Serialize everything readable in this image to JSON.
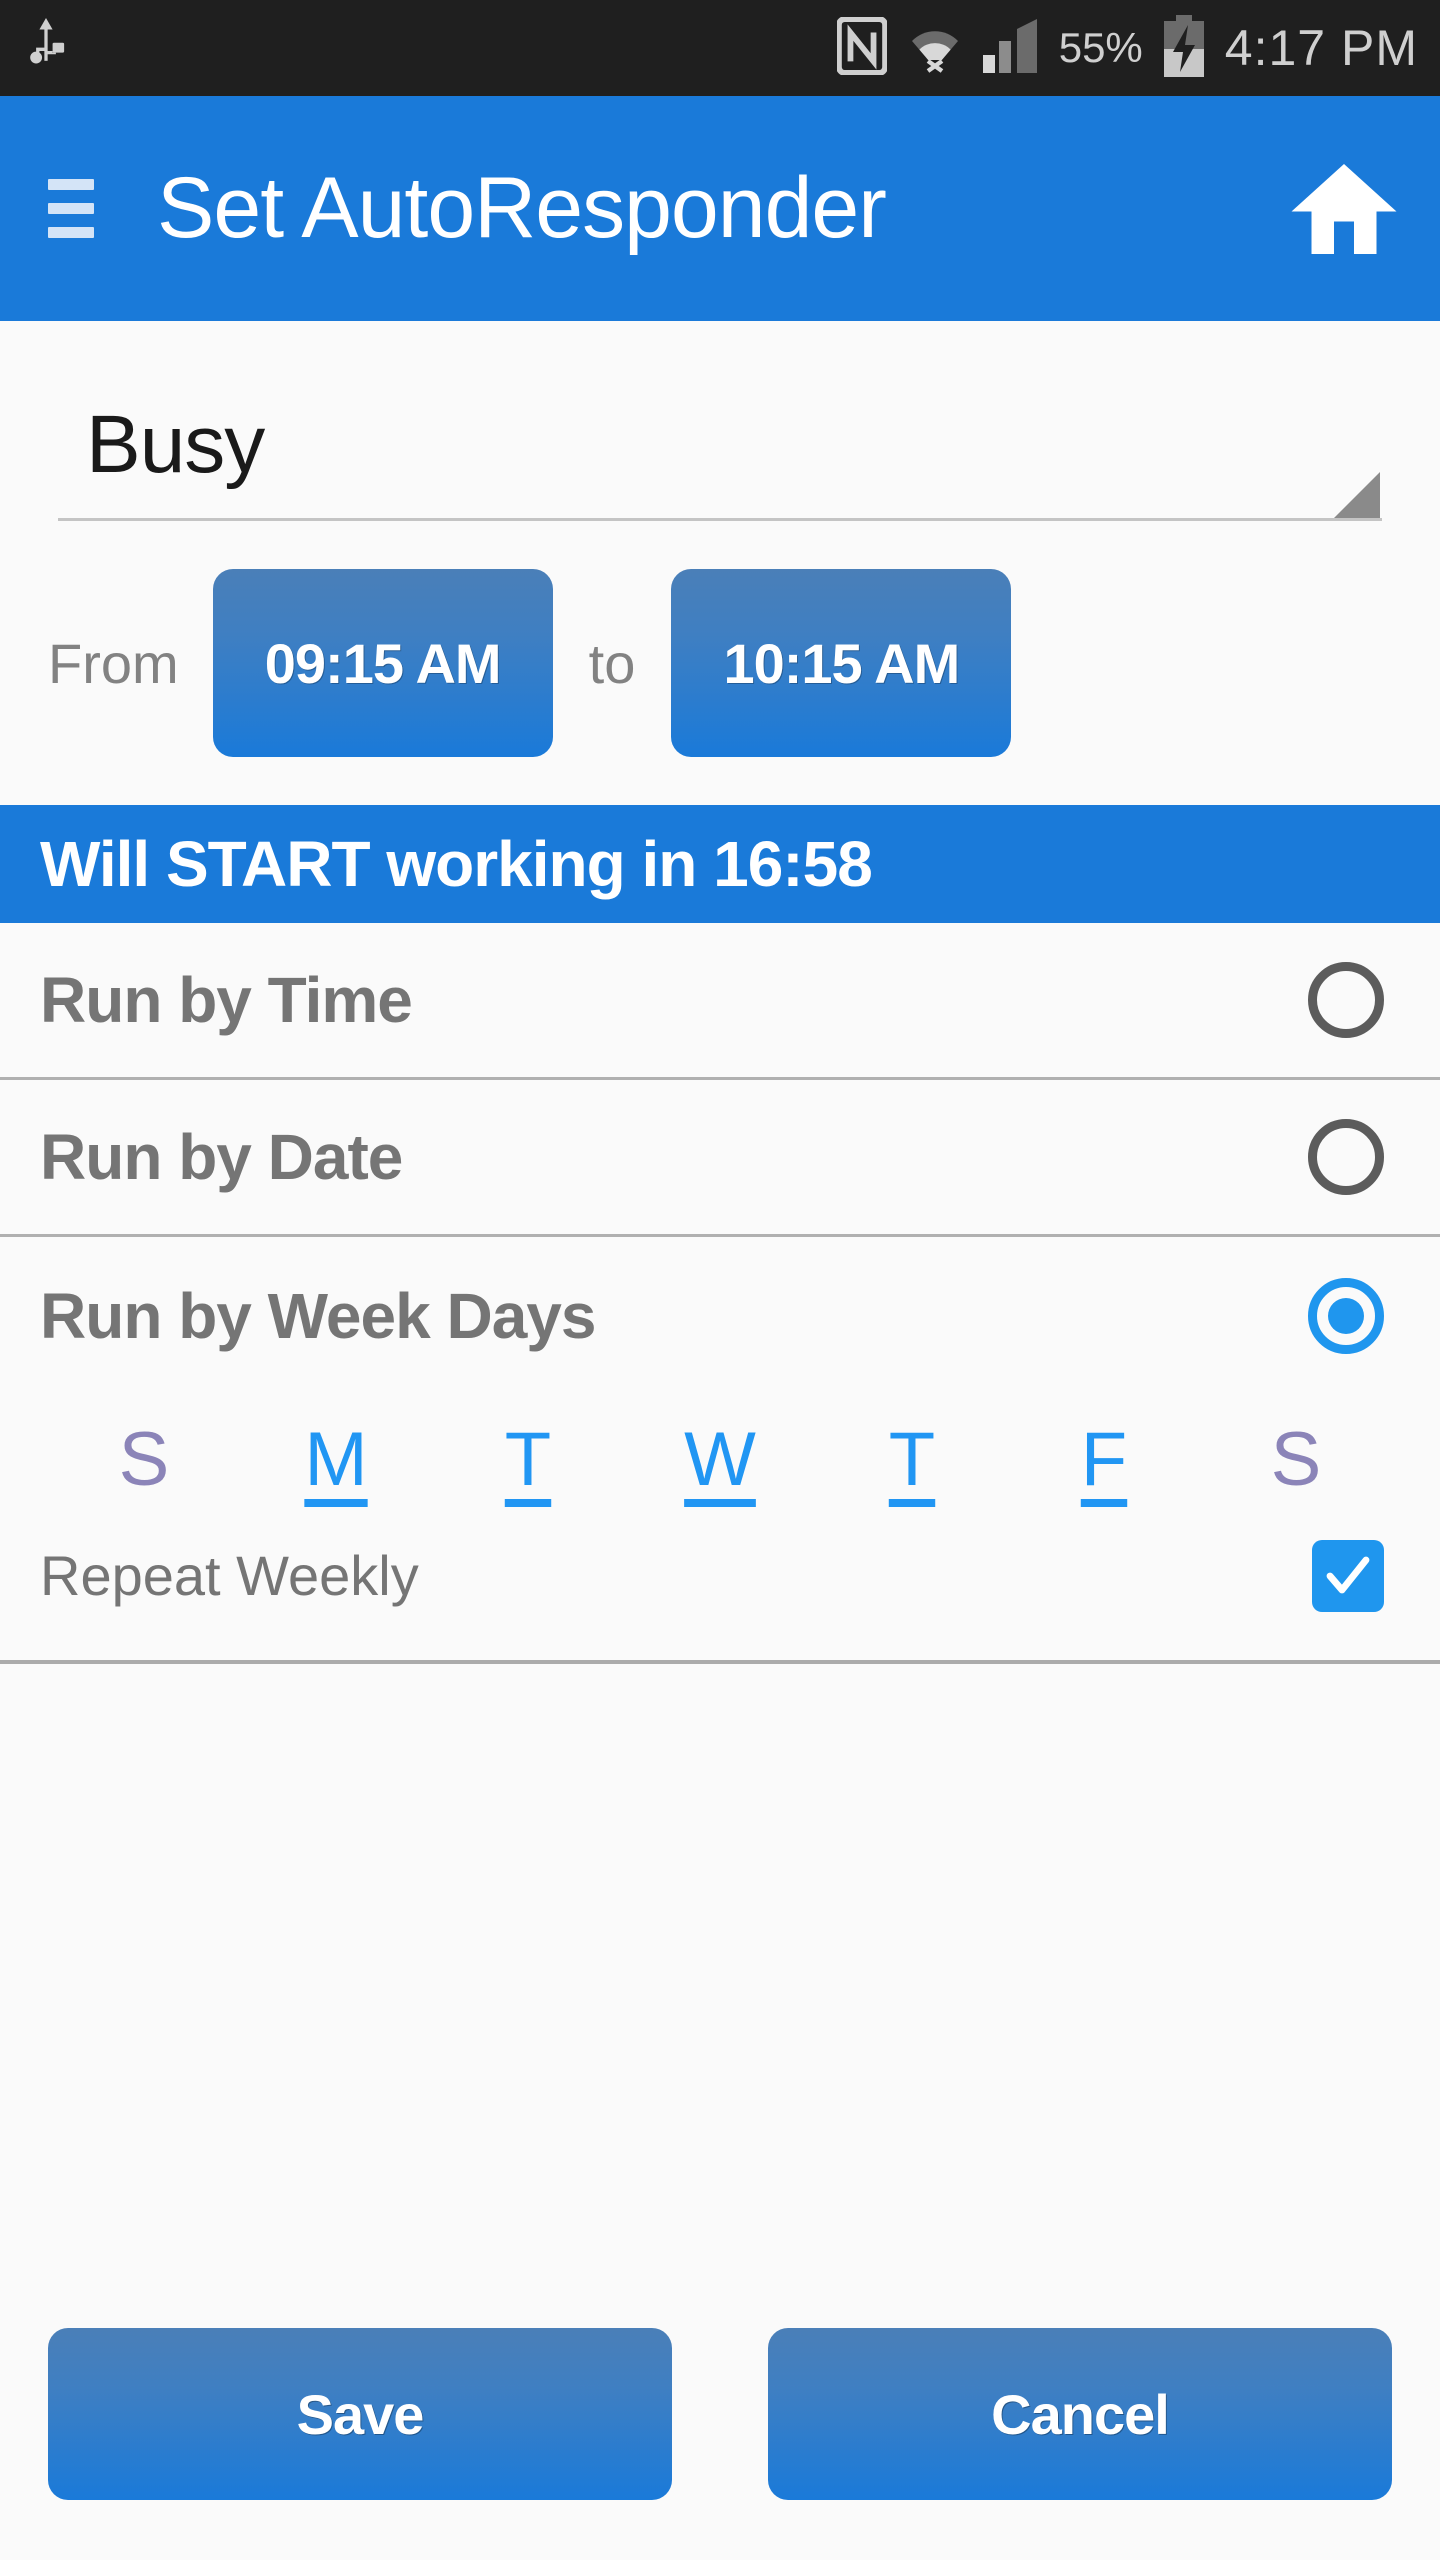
{
  "statusbar": {
    "usb_icon": "usb-icon",
    "nfc_icon": "nfc-icon",
    "wifi_icon": "wifi-icon",
    "signal_icon": "cellular-signal-icon",
    "battery_percent": "55%",
    "battery_icon": "battery-charging-icon",
    "time": "4:17 PM"
  },
  "actionbar": {
    "menu_icon": "hamburger-menu-icon",
    "title": "Set AutoResponder",
    "home_icon": "home-icon"
  },
  "spinner": {
    "selected": "Busy",
    "arrow_icon": "dropdown-triangle-icon"
  },
  "schedule": {
    "from_label": "From",
    "from_time": "09:15 AM",
    "to_label": "to",
    "to_time": "10:15 AM"
  },
  "banner": {
    "text": "Will START working in 16:58"
  },
  "run_modes": [
    {
      "label": "Run by Time",
      "selected": false
    },
    {
      "label": "Run by Date",
      "selected": false
    },
    {
      "label": "Run by Week Days",
      "selected": true
    }
  ],
  "weekdays": [
    {
      "letter": "S",
      "selected": false
    },
    {
      "letter": "M",
      "selected": true
    },
    {
      "letter": "T",
      "selected": true
    },
    {
      "letter": "W",
      "selected": true
    },
    {
      "letter": "T",
      "selected": true
    },
    {
      "letter": "F",
      "selected": true
    },
    {
      "letter": "S",
      "selected": false
    }
  ],
  "repeat": {
    "label": "Repeat Weekly",
    "checked": true,
    "check_icon": "checkmark-icon"
  },
  "footer": {
    "save_label": "Save",
    "cancel_label": "Cancel"
  },
  "colors": {
    "accent_blue": "#1a7ad9",
    "bright_blue": "#1f96ee",
    "statusbar_bg": "#1f1f1f",
    "page_bg": "#fafafa",
    "label_grey": "#757575",
    "unselected_day": "#8b84b8"
  }
}
